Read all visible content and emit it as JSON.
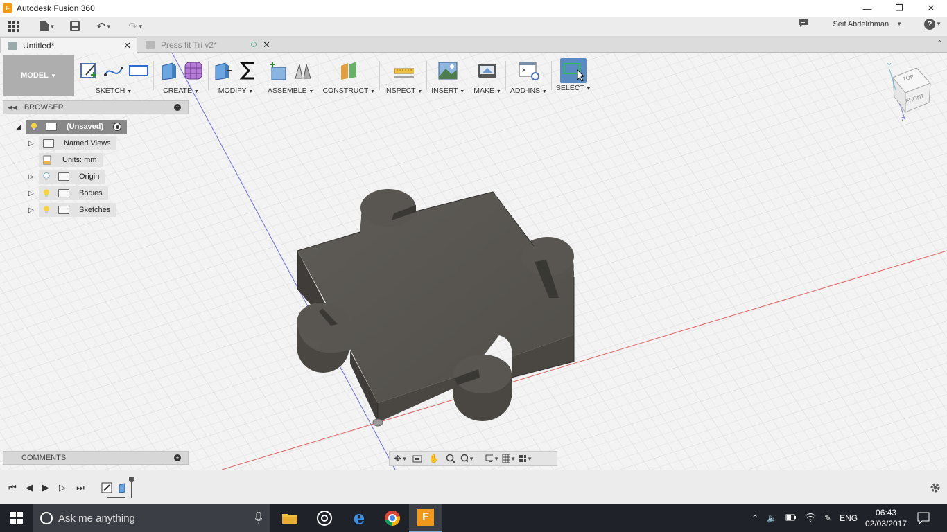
{
  "window": {
    "title": "Autodesk Fusion 360",
    "app_icon": "F",
    "controls": [
      "minimize-icon",
      "restore-icon",
      "close-icon"
    ]
  },
  "quick_access": {
    "user_name": "Seif Abdelrhman",
    "help": "?"
  },
  "tabs": [
    {
      "label": "Untitled*",
      "active": true
    },
    {
      "label": "Press fit Tri v2*",
      "active": false
    }
  ],
  "toolbar": {
    "workspace": "MODEL",
    "groups": [
      {
        "label": "SKETCH"
      },
      {
        "label": "CREATE"
      },
      {
        "label": "MODIFY"
      },
      {
        "label": "ASSEMBLE"
      },
      {
        "label": "CONSTRUCT"
      },
      {
        "label": "INSPECT"
      },
      {
        "label": "INSERT"
      },
      {
        "label": "MAKE"
      },
      {
        "label": "ADD-INS"
      },
      {
        "label": "SELECT"
      }
    ]
  },
  "browser": {
    "title": "BROWSER",
    "root": "(Unsaved)",
    "items": [
      {
        "label": "Named Views"
      },
      {
        "label": "Units: mm"
      },
      {
        "label": "Origin"
      },
      {
        "label": "Bodies"
      },
      {
        "label": "Sketches"
      }
    ]
  },
  "viewcube": {
    "top": "TOP",
    "front": "FRONT",
    "axis_y": "Y",
    "axis_z": "Z"
  },
  "comments": {
    "title": "COMMENTS"
  },
  "taskbar": {
    "search_placeholder": "Ask me anything",
    "language": "ENG",
    "time": "06:43",
    "date": "02/03/2017"
  },
  "colors": {
    "accent": "#5a8ac2",
    "body_top": "#585550",
    "body_side": "#45423e",
    "taskbar": "#1f2329"
  }
}
